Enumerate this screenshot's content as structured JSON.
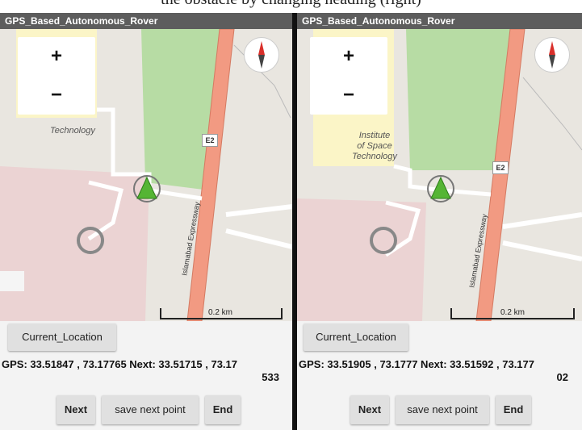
{
  "caption": "the obstacle by changing heading (right)",
  "screens": [
    {
      "app_title": "GPS_Based_Autonomous_Rover",
      "zoom_in": "+",
      "zoom_out": "−",
      "map_labels": {
        "place": "Technology",
        "road_name": "Islamabad Expressway",
        "road_shield": "E2",
        "scale": "0.2 km"
      },
      "current_location_label": "Current_Location",
      "gps_line1": "GPS: 33.51847 , 73.17765 Next: 33.51715 , 73.17",
      "gps_line2": "533",
      "buttons": {
        "next": "Next",
        "save": "save next point",
        "end": "End"
      }
    },
    {
      "app_title": "GPS_Based_Autonomous_Rover",
      "zoom_in": "+",
      "zoom_out": "−",
      "map_labels": {
        "place_1": "Institute",
        "place_2": "of Space",
        "place_3": "Technology",
        "road_name": "Islamabad Expressway",
        "road_shield": "E2",
        "scale": "0.2 km"
      },
      "current_location_label": "Current_Location",
      "gps_line1": "GPS: 33.51905 , 73.1777 Next: 33.51592 , 73.177",
      "gps_line2": "02",
      "buttons": {
        "next": "Next",
        "save": "save next point",
        "end": "End"
      }
    }
  ],
  "colors": {
    "park": "#b7dca4",
    "road": "#f29a82",
    "building": "#fbf5c7",
    "restricted": "#ebd3d3",
    "marker": "#55b534"
  }
}
